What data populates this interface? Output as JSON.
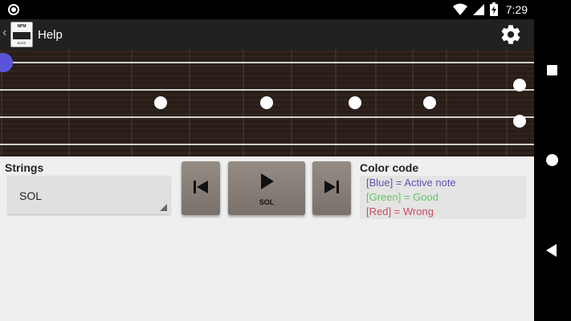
{
  "status_bar": {
    "time": "7:29",
    "icons": [
      "record-icon",
      "wifi-icon",
      "signal-icon",
      "battery-charging-icon"
    ]
  },
  "app_bar": {
    "title": "Help",
    "logo_text_top": "NPM",
    "logo_text_bottom": "BASS",
    "back_icon": "chevron-left-icon",
    "settings_icon": "gear-icon"
  },
  "fretboard": {
    "strings": 4,
    "frets": 12,
    "inlay_markers": [
      "fret-3",
      "fret-5",
      "fret-7",
      "fret-9",
      "fret-12-double"
    ],
    "active_note": {
      "string": 1,
      "fret": 0,
      "color": "#5a55d8"
    },
    "colors": {
      "wood": "#2a1f1a",
      "string": "#d8d8d8",
      "marker": "#ffffff"
    }
  },
  "controls": {
    "strings_label": "Strings",
    "strings_selected": "SOL",
    "prev_icon": "skip-previous-icon",
    "play_icon": "play-icon",
    "play_label": "SOL",
    "next_icon": "skip-next-icon"
  },
  "color_code": {
    "title": "Color code",
    "blue": "[Blue] = Active note",
    "green": "[Green] = Good",
    "red": "[Red] = Wrong",
    "colors": {
      "blue": "#5b55b5",
      "green": "#63c463",
      "red": "#cc4a5a"
    }
  },
  "nav_bar": {
    "icons": [
      "recents-square-icon",
      "home-circle-icon",
      "back-triangle-icon"
    ]
  }
}
